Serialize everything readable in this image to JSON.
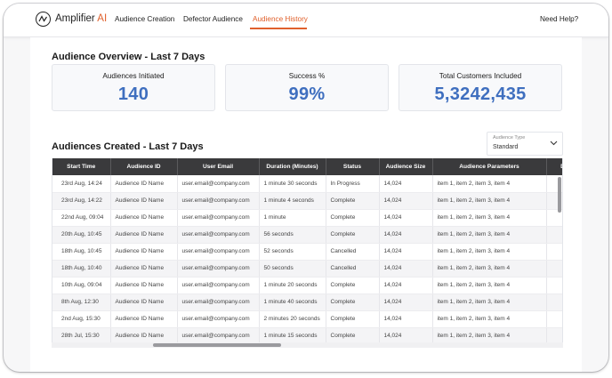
{
  "brand": {
    "name": "Amplifier",
    "suffix": "AI"
  },
  "nav": {
    "tabs": [
      {
        "label": "Audience Creation"
      },
      {
        "label": "Defector Audience"
      },
      {
        "label": "Audience History"
      }
    ],
    "active_tab": "Audience History",
    "help": "Need Help?"
  },
  "overview": {
    "title": "Audience Overview - Last 7 Days",
    "cards": [
      {
        "label": "Audiences Initiated",
        "value": "140"
      },
      {
        "label": "Success %",
        "value": "99%"
      },
      {
        "label": "Total Customers Included",
        "value": "5,3242,435"
      }
    ]
  },
  "created": {
    "title": "Audiences Created - Last 7 Days",
    "filter": {
      "caption": "Audience Type",
      "value": "Standard"
    },
    "columns": [
      "Start Time",
      "Audience ID",
      "User Email",
      "Duration (Minutes)",
      "Status",
      "Audience Size",
      "Audience Parameters",
      "D"
    ],
    "rows": [
      [
        "23rd Aug, 14:24",
        "Audience ID Name",
        "user.email@company.com",
        "1 minute 30 seconds",
        "In Progress",
        "14,024",
        "item 1, item 2, item 3, item 4"
      ],
      [
        "23rd Aug, 14:22",
        "Audience ID Name",
        "user.email@company.com",
        "1 minute 4 seconds",
        "Complete",
        "14,024",
        "item 1, item 2, item 3, item 4"
      ],
      [
        "22nd Aug, 09:04",
        "Audience ID Name",
        "user.email@company.com",
        "1 minute",
        "Complete",
        "14,024",
        "item 1, item 2, item 3, item 4"
      ],
      [
        "20th Aug, 10:45",
        "Audience ID Name",
        "user.email@company.com",
        "56 seconds",
        "Complete",
        "14,024",
        "item 1, item 2, item 3, item 4"
      ],
      [
        "18th Aug, 10:45",
        "Audience ID Name",
        "user.email@company.com",
        "52 seconds",
        "Cancelled",
        "14,024",
        "item 1, item 2, item 3, item 4"
      ],
      [
        "18th Aug, 10:40",
        "Audience ID Name",
        "user.email@company.com",
        "50 seconds",
        "Cancelled",
        "14,024",
        "item 1, item 2, item 3, item 4"
      ],
      [
        "10th Aug, 09:04",
        "Audience ID Name",
        "user.email@company.com",
        "1 minute 20 seconds",
        "Complete",
        "14,024",
        "item 1, item 2, item 3, item 4"
      ],
      [
        "8th Aug, 12:30",
        "Audience ID Name",
        "user.email@company.com",
        "1 minute 40 seconds",
        "Complete",
        "14,024",
        "item 1, item 2, item 3, item 4"
      ],
      [
        "2nd Aug, 15:30",
        "Audience ID Name",
        "user.email@company.com",
        "2 minutes 20 seconds",
        "Complete",
        "14,024",
        "item 1, item 2, item 3, item 4"
      ],
      [
        "28th Jul, 15:30",
        "Audience ID Name",
        "user.email@company.com",
        "1 minute 15 seconds",
        "Complete",
        "14,024",
        "item 1, item 2, item 3, item 4"
      ]
    ]
  },
  "colors": {
    "accent": "#e0602c",
    "metric": "#3f6fbf",
    "table_header": "#3a3a3c"
  },
  "icons": {
    "logo": "amplifier-logo-icon",
    "select": "chevron-down-icon"
  }
}
